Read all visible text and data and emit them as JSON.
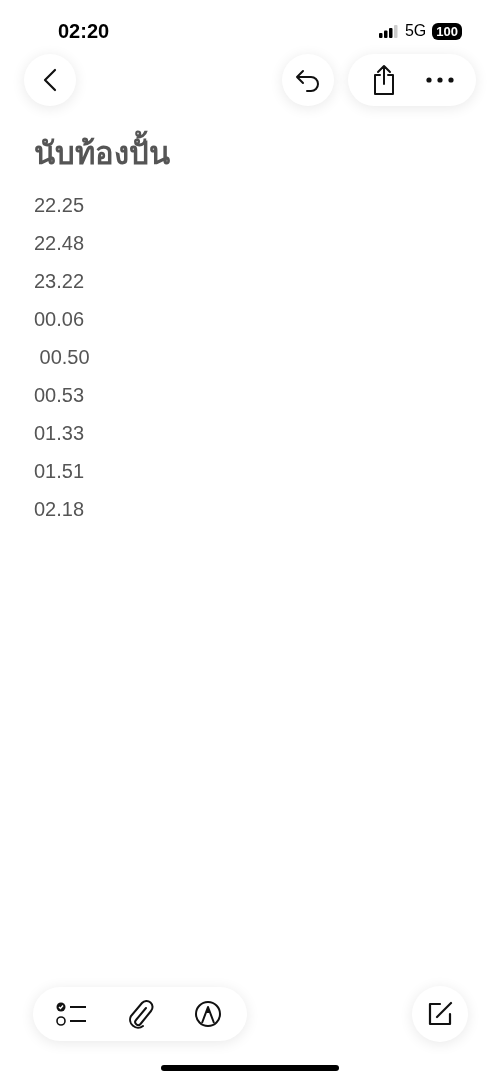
{
  "status_bar": {
    "time": "02:20",
    "network": "5G",
    "battery": "100"
  },
  "note": {
    "title": "นับท้องปั้น",
    "lines": [
      "22.25",
      "22.48",
      "23.22",
      "00.06",
      " 00.50",
      "00.53",
      "01.33",
      "01.51",
      "02.18"
    ]
  }
}
